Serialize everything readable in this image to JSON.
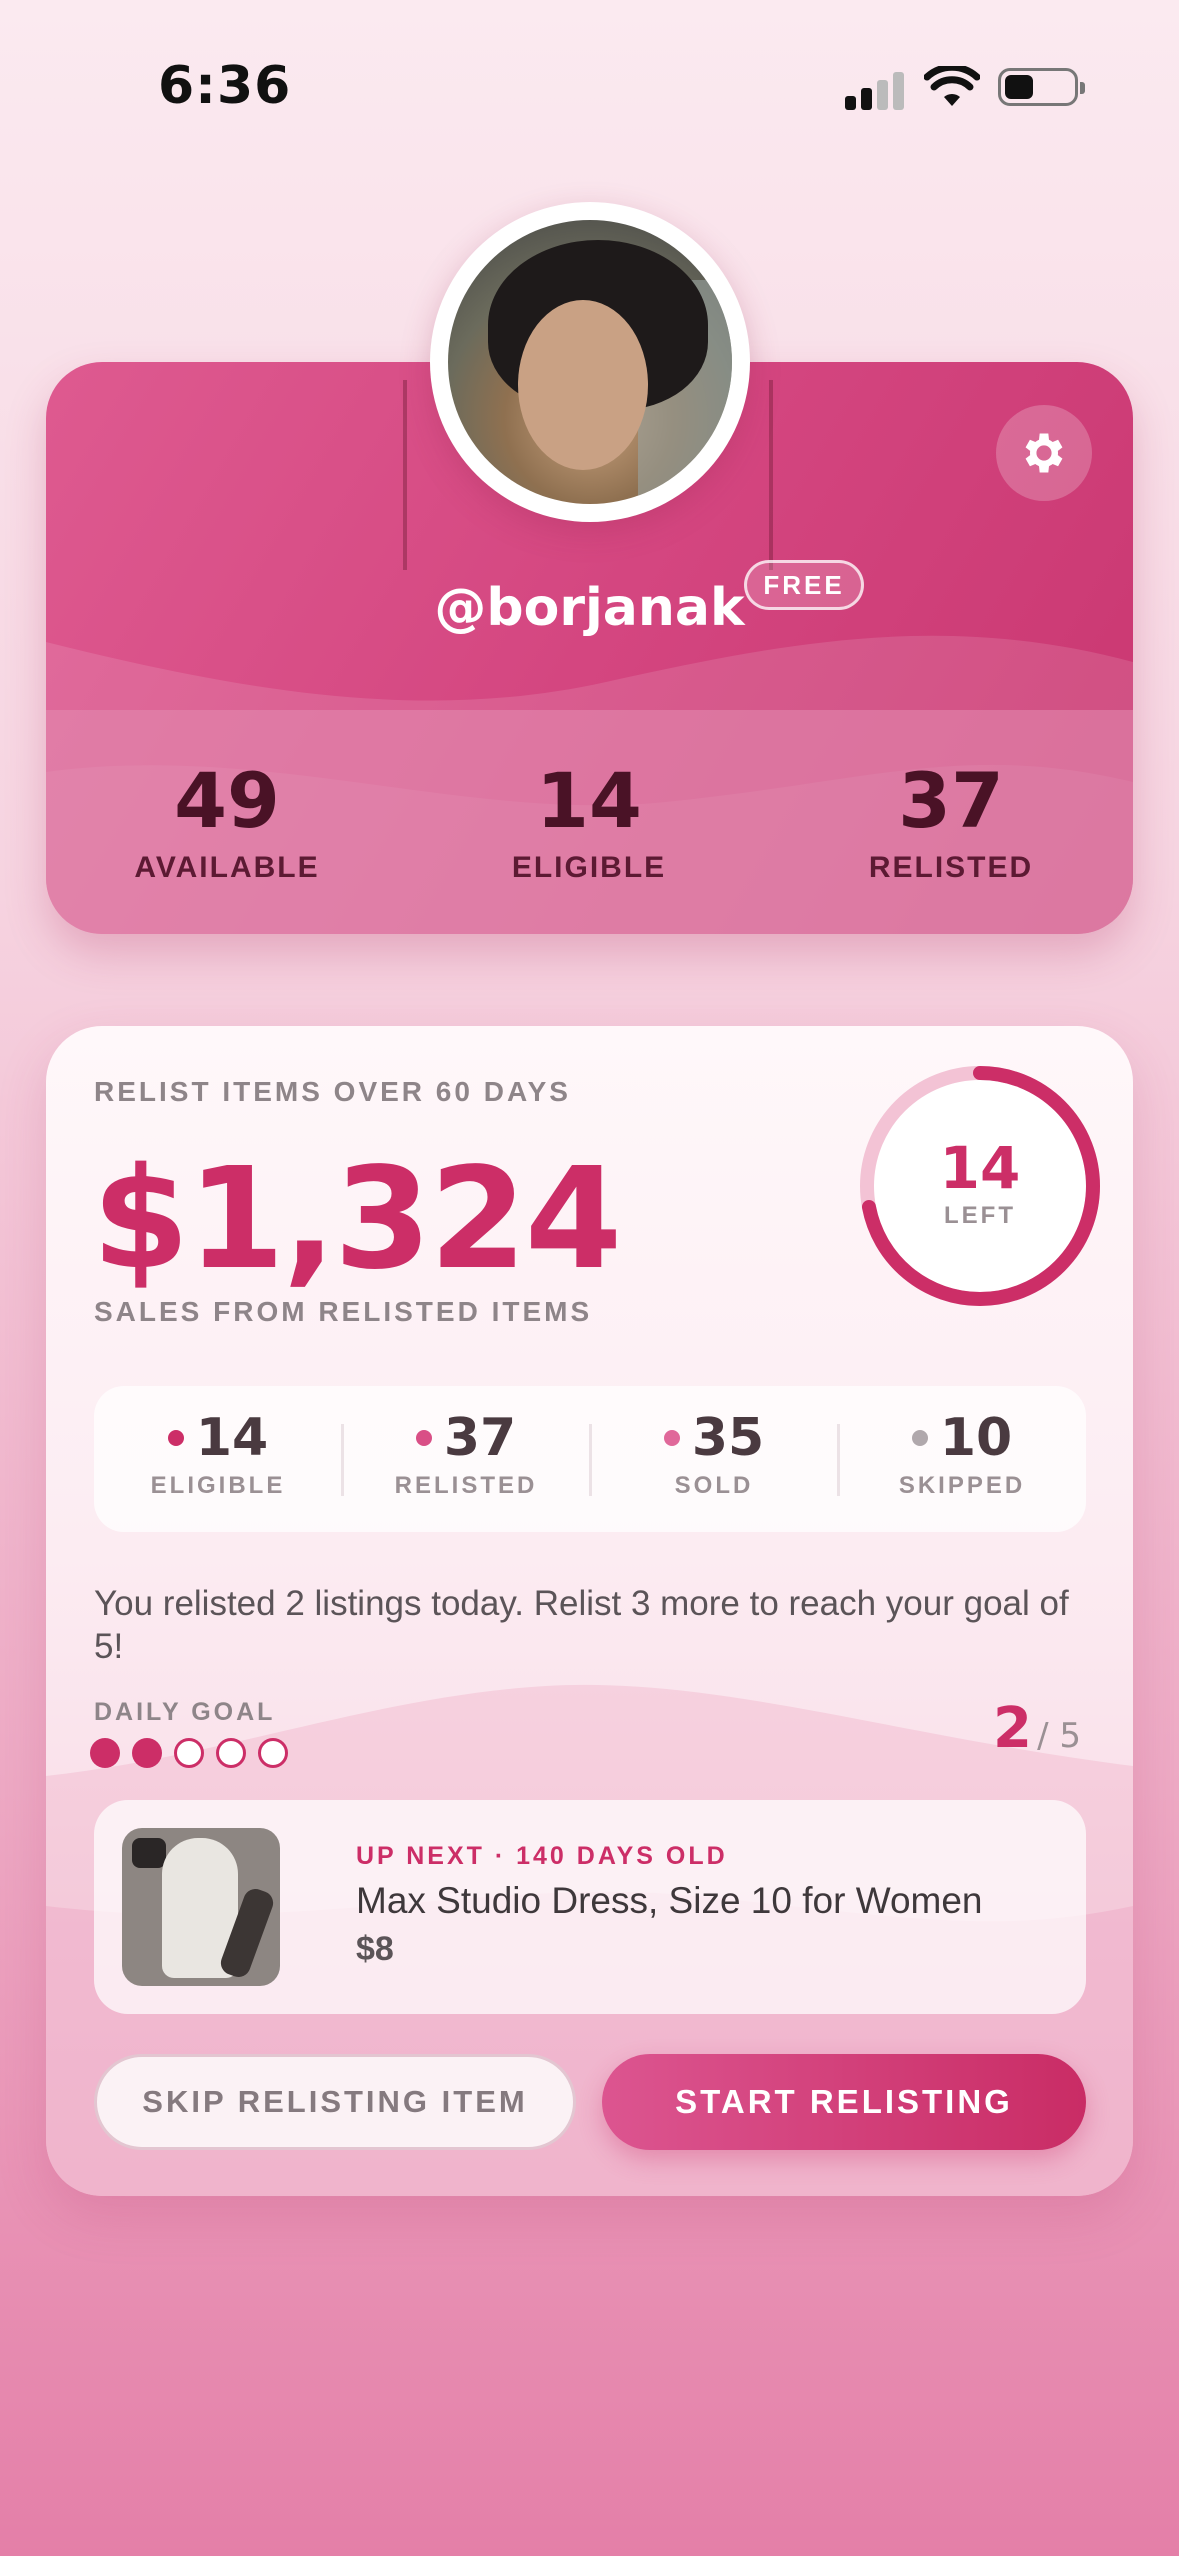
{
  "status_bar": {
    "time": "6:36"
  },
  "profile": {
    "username": "@borjanak",
    "plan_badge": "FREE",
    "stats": [
      {
        "value": "49",
        "label": "AVAILABLE"
      },
      {
        "value": "14",
        "label": "ELIGIBLE"
      },
      {
        "value": "37",
        "label": "RELISTED"
      }
    ]
  },
  "relist": {
    "heading": "RELIST ITEMS OVER 60 DAYS",
    "amount": "$1,324",
    "amount_label": "SALES FROM RELISTED ITEMS",
    "ring": {
      "value": "14",
      "label": "LEFT",
      "progress_fraction": 0.72
    },
    "mini_stats": [
      {
        "value": "14",
        "label": "ELIGIBLE",
        "dot_color": "#cc2e67"
      },
      {
        "value": "37",
        "label": "RELISTED",
        "dot_color": "#d94f86"
      },
      {
        "value": "35",
        "label": "SOLD",
        "dot_color": "#e0689a"
      },
      {
        "value": "10",
        "label": "SKIPPED",
        "dot_color": "#b0a8ac"
      }
    ],
    "message": "You relisted 2 listings today. Relist 3 more to reach your goal of 5!",
    "daily_goal": {
      "label": "DAILY GOAL",
      "current": "2",
      "total": "/ 5",
      "completed": 2,
      "goal": 5
    },
    "up_next": {
      "label": "UP NEXT · 140 DAYS OLD",
      "title": "Max Studio Dress, Size 10 for Women",
      "price": "$8"
    },
    "skip_label": "SKIP RELISTING ITEM",
    "start_label": "START RELISTING"
  },
  "colors": {
    "accent": "#cc2e67",
    "muted": "#9a9094"
  }
}
